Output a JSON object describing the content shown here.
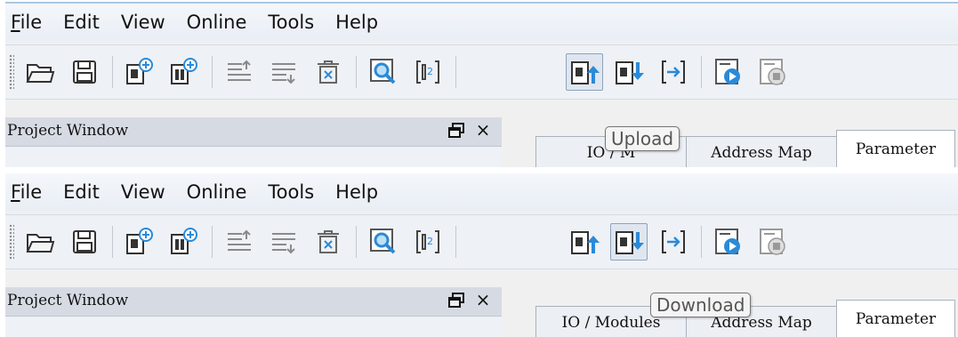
{
  "colors": {
    "toolbar_bg": "#eef1f6",
    "pressed_bg": "#dfe6ef",
    "accent_blue": "#2a8ad8",
    "icon_green": "#2aa84a"
  },
  "panels": [
    {
      "menu": [
        {
          "label": "File",
          "mnemonic": "F",
          "rest": "ile"
        },
        {
          "label": "Edit"
        },
        {
          "label": "View"
        },
        {
          "label": "Online"
        },
        {
          "label": "Tools"
        },
        {
          "label": "Help"
        }
      ],
      "pressed_tool": "upload",
      "tooltip": "Upload",
      "project_window": {
        "title": "Project Window",
        "close": "×"
      },
      "tabs": [
        "IO / M",
        "Address Map",
        "Parameter"
      ]
    },
    {
      "menu": [
        {
          "label": "File",
          "mnemonic": "F",
          "rest": "ile"
        },
        {
          "label": "Edit"
        },
        {
          "label": "View"
        },
        {
          "label": "Online"
        },
        {
          "label": "Tools"
        },
        {
          "label": "Help"
        }
      ],
      "pressed_tool": "download",
      "tooltip": "Download",
      "project_window": {
        "title": "Project Window",
        "close": "×"
      },
      "tabs": [
        "IO / Modules",
        "Address Map",
        "Parameter"
      ]
    }
  ],
  "toolbar_icons": [
    "open-folder-icon",
    "save-icon",
    "add-device-icon",
    "add-module-icon",
    "move-up-icon",
    "move-down-icon",
    "delete-icon",
    "scan-icon",
    "io-mapping-icon",
    "upload-icon",
    "download-icon",
    "transfer-icon",
    "run-icon",
    "stop-icon"
  ]
}
